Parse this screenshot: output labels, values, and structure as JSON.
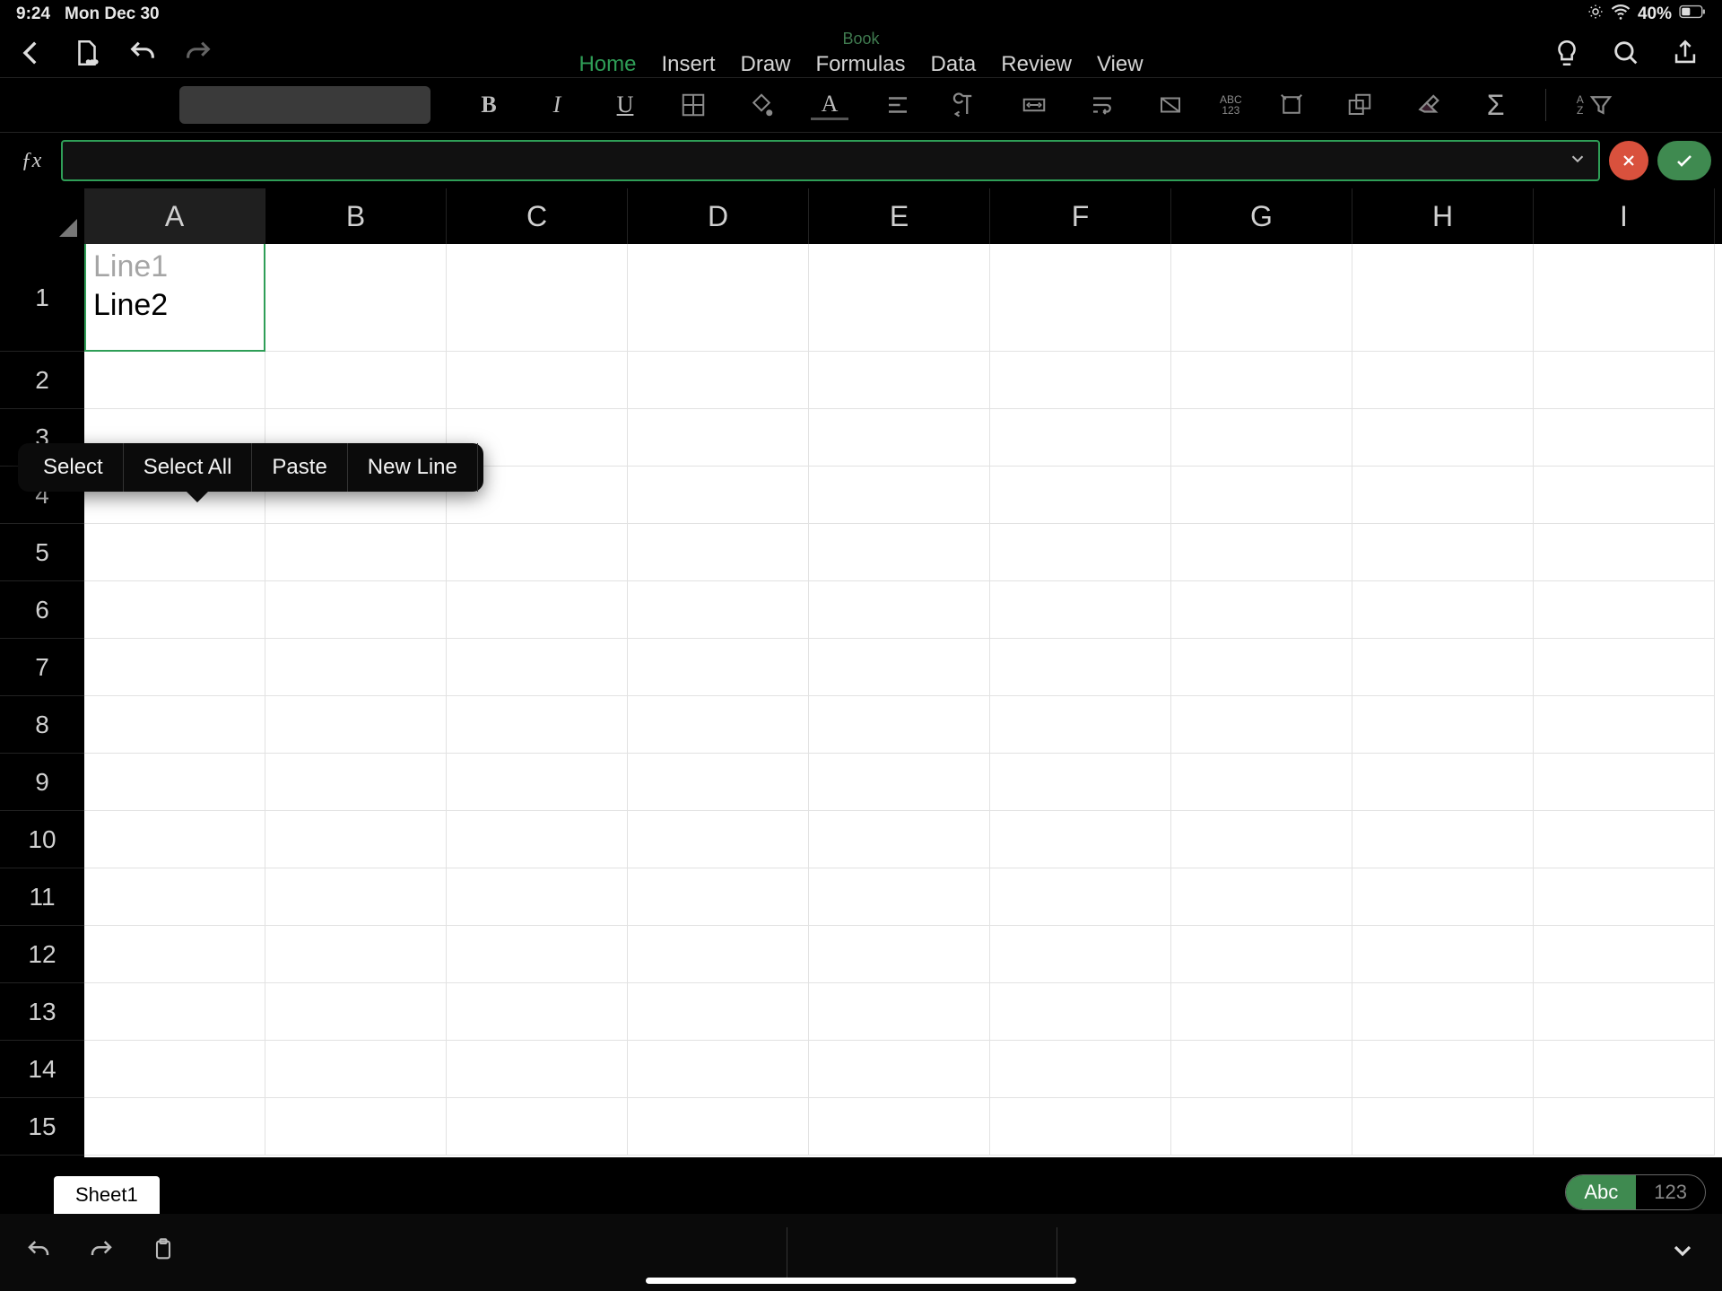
{
  "status": {
    "time": "9:24",
    "date": "Mon Dec 30",
    "battery": "40%"
  },
  "document": {
    "title": "Book"
  },
  "ribbon": {
    "tabs": [
      "Home",
      "Insert",
      "Draw",
      "Formulas",
      "Data",
      "Review",
      "View"
    ],
    "active": "Home"
  },
  "context_menu": {
    "items": [
      "Select",
      "Select All",
      "Paste",
      "New Line"
    ]
  },
  "columns": [
    "A",
    "B",
    "C",
    "D",
    "E",
    "F",
    "G",
    "H",
    "I"
  ],
  "rows": [
    "1",
    "2",
    "3",
    "4",
    "5",
    "6",
    "7",
    "8",
    "9",
    "10",
    "11",
    "12",
    "13",
    "14",
    "15"
  ],
  "cells": {
    "A1_line1": "Line1",
    "A1_line2": "Line2"
  },
  "sheet": {
    "active": "Sheet1"
  },
  "keyboard_toggle": {
    "abc": "Abc",
    "num": "123"
  },
  "toolbar": {
    "abc123_top": "ABC",
    "abc123_bot": "123",
    "az_top": "A",
    "az_bot": "Z"
  }
}
